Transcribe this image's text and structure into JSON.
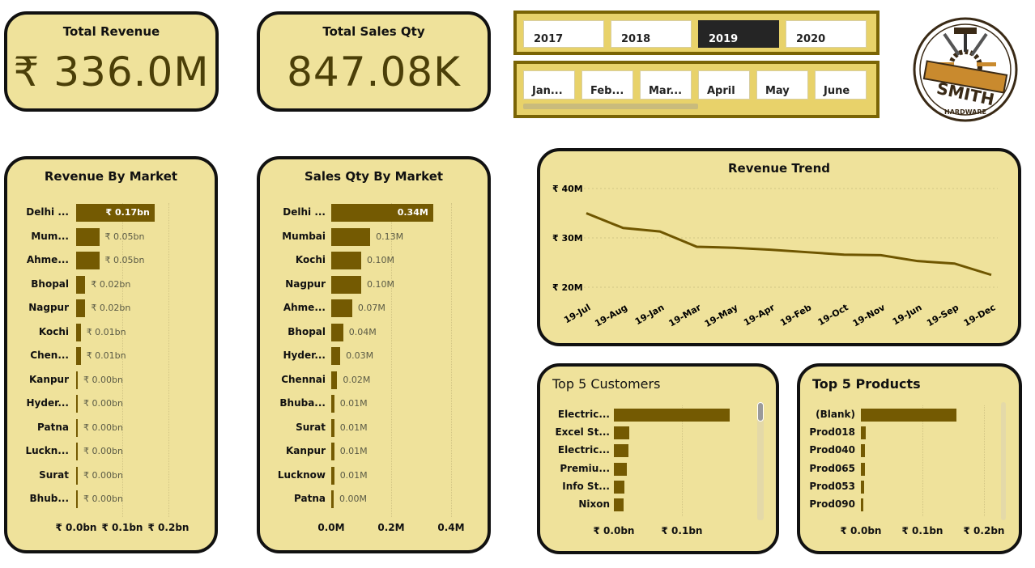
{
  "kpis": {
    "revenue": {
      "title": "Total Revenue",
      "value": "₹ 336.0M"
    },
    "qty": {
      "title": "Total Sales Qty",
      "value": "847.08K"
    }
  },
  "year_slicer": {
    "options": [
      "2017",
      "2018",
      "2019",
      "2020"
    ],
    "selected": "2019"
  },
  "month_slicer": {
    "options": [
      "Jan...",
      "Feb...",
      "Mar...",
      "April",
      "May",
      "June"
    ]
  },
  "logo": {
    "text": "SMITH",
    "subtext": "HARDWARE"
  },
  "revenue_by_market": {
    "title": "Revenue By Market",
    "labels": [
      "Delhi ...",
      "Mum...",
      "Ahme...",
      "Bhopal",
      "Nagpur",
      "Kochi",
      "Chen...",
      "Kanpur",
      "Hyder...",
      "Patna",
      "Luckn...",
      "Surat",
      "Bhub..."
    ],
    "value_labels": [
      "₹ 0.17bn",
      "₹ 0.05bn",
      "₹ 0.05bn",
      "₹ 0.02bn",
      "₹ 0.02bn",
      "₹ 0.01bn",
      "₹ 0.01bn",
      "₹ 0.00bn",
      "₹ 0.00bn",
      "₹ 0.00bn",
      "₹ 0.00bn",
      "₹ 0.00bn",
      "₹ 0.00bn"
    ],
    "axis_ticks": [
      "₹ 0.0bn",
      "₹ 0.1bn",
      "₹ 0.2bn"
    ]
  },
  "sales_qty_by_market": {
    "title": "Sales Qty By Market",
    "labels": [
      "Delhi ...",
      "Mumbai",
      "Kochi",
      "Nagpur",
      "Ahme...",
      "Bhopal",
      "Hyder...",
      "Chennai",
      "Bhuba...",
      "Surat",
      "Kanpur",
      "Lucknow",
      "Patna"
    ],
    "value_labels": [
      "0.34M",
      "0.13M",
      "0.10M",
      "0.10M",
      "0.07M",
      "0.04M",
      "0.03M",
      "0.02M",
      "0.01M",
      "0.01M",
      "0.01M",
      "0.01M",
      "0.00M"
    ],
    "axis_ticks": [
      "0.0M",
      "0.2M",
      "0.4M"
    ]
  },
  "revenue_trend": {
    "title": "Revenue Trend",
    "y_ticks": [
      "₹ 40M",
      "₹ 30M",
      "₹ 20M"
    ],
    "x_ticks": [
      "19-Jul",
      "19-Aug",
      "19-Jan",
      "19-Mar",
      "19-May",
      "19-Apr",
      "19-Feb",
      "19-Oct",
      "19-Nov",
      "19-Jun",
      "19-Sep",
      "19-Dec"
    ]
  },
  "top_customers": {
    "title": "Top 5 Customers",
    "labels": [
      "Electric...",
      "Excel St...",
      "Electric...",
      "Premiu...",
      "Info St...",
      "Nixon"
    ],
    "axis_ticks": [
      "₹ 0.0bn",
      "₹ 0.1bn"
    ]
  },
  "top_products": {
    "title": "Top 5 Products",
    "labels": [
      "(Blank)",
      "Prod018",
      "Prod040",
      "Prod065",
      "Prod053",
      "Prod090"
    ],
    "axis_ticks": [
      "₹ 0.0bn",
      "₹ 0.1bn",
      "₹ 0.2bn"
    ]
  },
  "chart_data": [
    {
      "type": "bar",
      "orientation": "horizontal",
      "title": "Revenue By Market",
      "categories": [
        "Delhi ...",
        "Mum...",
        "Ahme...",
        "Bhopal",
        "Nagpur",
        "Kochi",
        "Chen...",
        "Kanpur",
        "Hyder...",
        "Patna",
        "Luckn...",
        "Surat",
        "Bhub..."
      ],
      "values": [
        0.17,
        0.05,
        0.05,
        0.02,
        0.02,
        0.01,
        0.01,
        0.0,
        0.0,
        0.0,
        0.0,
        0.0,
        0.0
      ],
      "unit": "₹ bn",
      "xlim": [
        0,
        0.2
      ]
    },
    {
      "type": "bar",
      "orientation": "horizontal",
      "title": "Sales Qty By Market",
      "categories": [
        "Delhi ...",
        "Mumbai",
        "Kochi",
        "Nagpur",
        "Ahme...",
        "Bhopal",
        "Hyder...",
        "Chennai",
        "Bhuba...",
        "Surat",
        "Kanpur",
        "Lucknow",
        "Patna"
      ],
      "values": [
        0.34,
        0.13,
        0.1,
        0.1,
        0.07,
        0.04,
        0.03,
        0.02,
        0.01,
        0.01,
        0.01,
        0.01,
        0.0
      ],
      "unit": "M",
      "xlim": [
        0,
        0.4
      ]
    },
    {
      "type": "line",
      "title": "Revenue Trend",
      "x": [
        "19-Jul",
        "19-Aug",
        "19-Jan",
        "19-Mar",
        "19-May",
        "19-Apr",
        "19-Feb",
        "19-Oct",
        "19-Nov",
        "19-Jun",
        "19-Sep",
        "19-Dec"
      ],
      "y": [
        35.0,
        32.0,
        31.3,
        28.2,
        28.0,
        27.6,
        27.1,
        26.6,
        26.5,
        25.3,
        24.8,
        22.5
      ],
      "unit": "₹ M",
      "ylim": [
        20,
        40
      ]
    },
    {
      "type": "bar",
      "orientation": "horizontal",
      "title": "Top 5 Customers",
      "categories": [
        "Electric...",
        "Excel St...",
        "Electric...",
        "Premiu...",
        "Info St...",
        "Nixon"
      ],
      "values": [
        0.17,
        0.023,
        0.021,
        0.019,
        0.016,
        0.014
      ],
      "unit": "₹ bn",
      "xlim": [
        0,
        0.2
      ]
    },
    {
      "type": "bar",
      "orientation": "horizontal",
      "title": "Top 5 Products",
      "categories": [
        "(Blank)",
        "Prod018",
        "Prod040",
        "Prod065",
        "Prod053",
        "Prod090"
      ],
      "values": [
        0.155,
        0.008,
        0.007,
        0.006,
        0.005,
        0.004
      ],
      "unit": "₹ bn",
      "xlim": [
        0,
        0.2
      ]
    }
  ],
  "colors": {
    "card_bg": "#efe29b",
    "bar": "#745a02",
    "slicer_bg": "#e8d26a",
    "border": "#111111",
    "selected": "#252525"
  }
}
